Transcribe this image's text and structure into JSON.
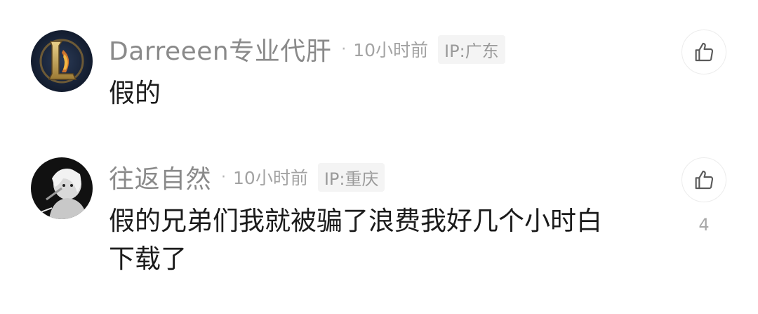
{
  "comments": [
    {
      "username": "Darreeen专业代肝",
      "dot": "·",
      "time": "10小时前",
      "ip": "IP:广东",
      "content": "假的",
      "like_count": "",
      "avatar_icon": "league-logo-avatar-icon",
      "like_icon": "thumbs-up-icon"
    },
    {
      "username": "往返自然",
      "dot": "·",
      "time": "10小时前",
      "ip": "IP:重庆",
      "content": "假的兄弟们我就被骗了浪费我好几个小时白下载了",
      "like_count": "4",
      "avatar_icon": "anime-character-avatar-icon",
      "like_icon": "thumbs-up-icon"
    }
  ]
}
